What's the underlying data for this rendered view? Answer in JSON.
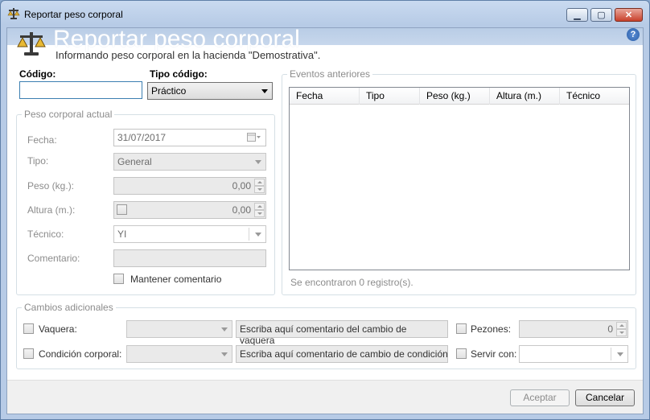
{
  "window": {
    "title": "Reportar peso corporal",
    "minimize": "▁",
    "maximize": "▢",
    "close": "✕"
  },
  "banner": {
    "title": "Reportar peso corporal",
    "subtitle": "Informando peso corporal en la hacienda \"Demostrativa\".",
    "help": "?"
  },
  "codigo": {
    "label": "Código:",
    "value": ""
  },
  "tipo_codigo": {
    "label": "Tipo código:",
    "value": "Práctico"
  },
  "peso_actual": {
    "title": "Peso corporal actual",
    "fecha": {
      "label": "Fecha:",
      "value": "31/07/2017"
    },
    "tipo": {
      "label": "Tipo:",
      "value": "General"
    },
    "peso": {
      "label": "Peso (kg.):",
      "value": "0,00"
    },
    "altura": {
      "label": "Altura (m.):",
      "value": "0,00"
    },
    "tecnico": {
      "label": "Técnico:",
      "value": "YI"
    },
    "comentario": {
      "label": "Comentario:",
      "value": ""
    },
    "mantener": {
      "label": "Mantener comentario"
    }
  },
  "eventos": {
    "title": "Eventos anteriores",
    "columns": [
      "Fecha",
      "Tipo",
      "Peso (kg.)",
      "Altura (m.)",
      "Técnico"
    ],
    "status": "Se encontraron 0 registro(s)."
  },
  "cambios": {
    "title": "Cambios adicionales",
    "vaquera": {
      "label": "Vaquera:",
      "placeholder": "Escriba aquí comentario del cambio de vaquera"
    },
    "condicion": {
      "label": "Condición corporal:",
      "placeholder": "Escriba aquí comentario de cambio de condición c"
    },
    "pezones": {
      "label": "Pezones:",
      "value": "0"
    },
    "servir": {
      "label": "Servir con:"
    }
  },
  "buttons": {
    "aceptar": "Aceptar",
    "cancelar": "Cancelar"
  },
  "colors": {
    "titlebar": "#b7cbe6",
    "close": "#c9402b",
    "border": "#5f7fa8"
  }
}
